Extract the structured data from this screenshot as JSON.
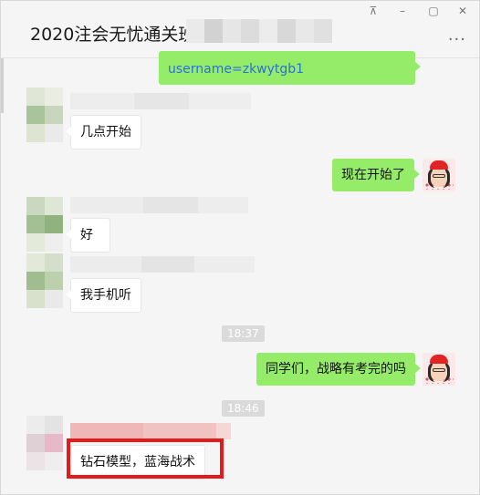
{
  "window": {
    "title": "2020注会无忧通关班",
    "controls": {
      "pin": "⊼",
      "minimize": "–",
      "maximize": "▢",
      "close": "✕"
    },
    "more": "···"
  },
  "messages": [
    {
      "side": "right",
      "type": "link",
      "text": "username=zkwytgb1"
    },
    {
      "side": "left",
      "text": "几点开始"
    },
    {
      "side": "right",
      "text": "现在开始了"
    },
    {
      "side": "left",
      "text": "好"
    },
    {
      "side": "left",
      "text": "我手机听"
    },
    {
      "type": "time",
      "text": "18:37"
    },
    {
      "side": "right",
      "text": "同学们，战略有考完的吗"
    },
    {
      "type": "time",
      "text": "18:46"
    },
    {
      "side": "left",
      "text": "钻石模型，蓝海战术"
    }
  ],
  "colors": {
    "bubble_self": "#95ec69",
    "link_text": "#2a6fdb",
    "highlight": "#e31b1b"
  }
}
